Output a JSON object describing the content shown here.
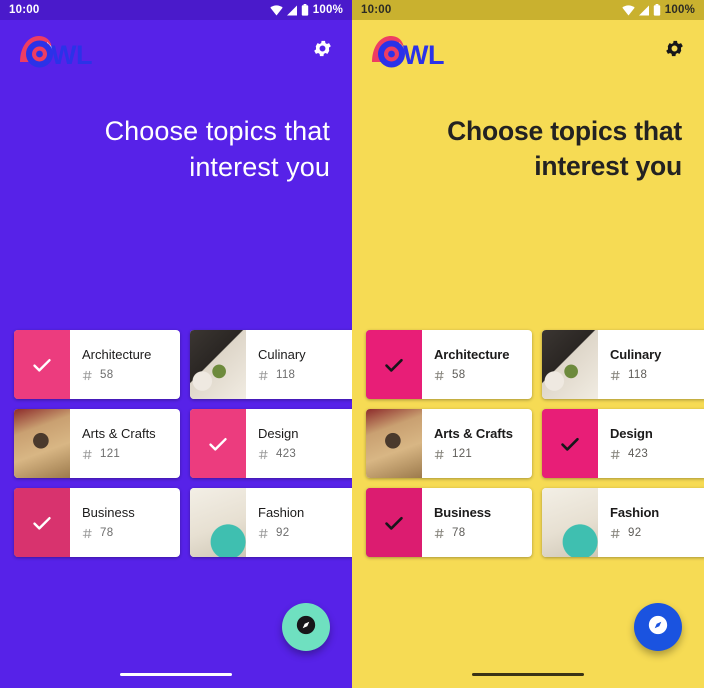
{
  "screen": {
    "app_name": "OWL",
    "title_line1": "Choose topics that",
    "title_line2": "interest you"
  },
  "status_bar": {
    "time": "10:00",
    "battery_percent": "100%",
    "icons": [
      "wifi-icon",
      "signal-icon",
      "battery-icon"
    ]
  },
  "app_bar": {
    "logo_text": "OWL",
    "settings_icon": "gear-icon"
  },
  "topics": [
    [
      {
        "name": "Architecture",
        "count": "58",
        "selected": true,
        "image": "architecture-photo"
      },
      {
        "name": "Culinary",
        "count": "118",
        "selected": false,
        "image": "culinary-photo"
      },
      {
        "name": "",
        "count": "",
        "selected": false,
        "image": "peek-photo-1"
      }
    ],
    [
      {
        "name": "Arts & Crafts",
        "count": "121",
        "selected": false,
        "image": "arts-crafts-photo"
      },
      {
        "name": "Design",
        "count": "423",
        "selected": true,
        "image": "design-photo"
      },
      {
        "name": "",
        "count": "",
        "selected": false,
        "image": "peek-photo-2"
      }
    ],
    [
      {
        "name": "Business",
        "count": "78",
        "selected": true,
        "image": "business-photo"
      },
      {
        "name": "Fashion",
        "count": "92",
        "selected": false,
        "image": "fashion-photo"
      },
      {
        "name": "",
        "count": "",
        "selected": false,
        "image": "peek-photo-3"
      }
    ]
  ],
  "fab": {
    "icon": "compass-explore-icon"
  },
  "themes": {
    "left": {
      "name": "purple-theme",
      "background": "#5722E8",
      "status_bar": "#4A1ACB",
      "title_color": "#FFFFFF",
      "selection_tint": "#EC3C7E",
      "check_color": "#FFFFFF",
      "fab_background": "#6FE0C0",
      "fab_icon_color": "#17161A",
      "gesture_bar": "#FFFFFF"
    },
    "right": {
      "name": "yellow-theme",
      "background": "#F6DB54",
      "status_bar": "#C9B12F",
      "title_color": "#232222",
      "selection_tint": "#E81E77",
      "check_color": "#17161A",
      "fab_background": "#1A53E0",
      "fab_icon_color": "#FFFFFF",
      "gesture_bar": "#3A3315"
    }
  },
  "logo_colors": {
    "teardrop": "#EE3D63",
    "letters": "#2B32E8"
  }
}
